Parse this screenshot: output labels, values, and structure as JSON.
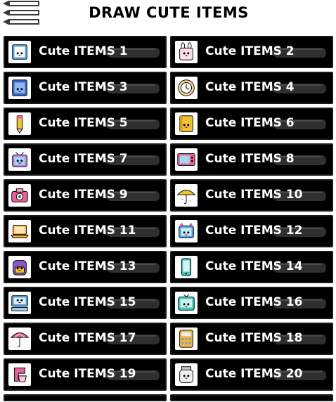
{
  "header": {
    "title": "DRAW CUTE ITEMS",
    "menu_icon": "pencil-menu-icon"
  },
  "items": [
    {
      "label": "Cute ITEMS 1",
      "icon": "cute-book-icon"
    },
    {
      "label": "Cute ITEMS 2",
      "icon": "cute-bunny-bag-icon"
    },
    {
      "label": "Cute ITEMS 3",
      "icon": "cute-notebook-icon"
    },
    {
      "label": "Cute ITEMS 4",
      "icon": "cute-clock-icon"
    },
    {
      "label": "Cute ITEMS 5",
      "icon": "cute-pencil-icon"
    },
    {
      "label": "Cute ITEMS 6",
      "icon": "cute-yellow-book-icon"
    },
    {
      "label": "Cute ITEMS 7",
      "icon": "cute-tv-icon"
    },
    {
      "label": "Cute ITEMS 8",
      "icon": "cute-microwave-icon"
    },
    {
      "label": "Cute ITEMS 9",
      "icon": "cute-camera-icon"
    },
    {
      "label": "Cute ITEMS 10",
      "icon": "cute-umbrella-icon"
    },
    {
      "label": "Cute ITEMS 11",
      "icon": "cute-laptop-icon"
    },
    {
      "label": "Cute ITEMS 12",
      "icon": "cute-robot-tv-icon"
    },
    {
      "label": "Cute ITEMS 13",
      "icon": "cute-backpack-icon"
    },
    {
      "label": "Cute ITEMS 14",
      "icon": "cute-phone-icon"
    },
    {
      "label": "Cute ITEMS 15",
      "icon": "cute-computer-icon"
    },
    {
      "label": "Cute ITEMS 16",
      "icon": "cute-teal-tv-icon"
    },
    {
      "label": "Cute ITEMS 17",
      "icon": "cute-pink-umbrella-icon"
    },
    {
      "label": "Cute ITEMS 18",
      "icon": "cute-calculator-icon"
    },
    {
      "label": "Cute ITEMS 19",
      "icon": "cute-mixer-icon"
    },
    {
      "label": "Cute ITEMS 20",
      "icon": "cute-jar-icon"
    }
  ],
  "colors": {
    "card_background": "#000000",
    "label_text": "#ffffff",
    "accent_pink": "#e8609a",
    "accent_blue": "#5aa7e0",
    "accent_yellow": "#f2c230",
    "accent_teal": "#3fc7c0"
  }
}
